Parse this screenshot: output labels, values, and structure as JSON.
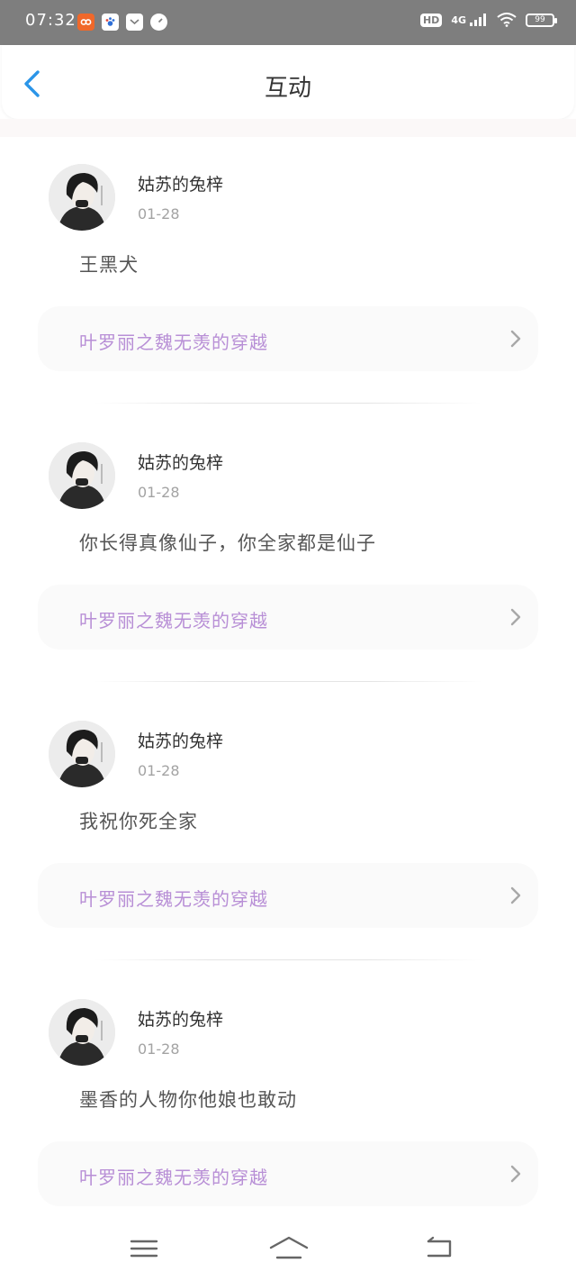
{
  "status_bar": {
    "time": "07:32",
    "hd": "HD",
    "network": "4G",
    "battery": "99"
  },
  "header": {
    "title": "互动",
    "back_icon": "chevron-left-icon"
  },
  "colors": {
    "accent": "#2b95e8",
    "book_title": "#b88fd6",
    "status_bar_bg": "#7e7e7e"
  },
  "feed": {
    "items": [
      {
        "username": "姑苏的兔梓",
        "date": "01-28",
        "comment": "王黑犬",
        "book_title": "叶罗丽之魏无羡的穿越"
      },
      {
        "username": "姑苏的兔梓",
        "date": "01-28",
        "comment": "你长得真像仙子，你全家都是仙子",
        "book_title": "叶罗丽之魏无羡的穿越"
      },
      {
        "username": "姑苏的兔梓",
        "date": "01-28",
        "comment": "我祝你死全家",
        "book_title": "叶罗丽之魏无羡的穿越"
      },
      {
        "username": "姑苏的兔梓",
        "date": "01-28",
        "comment": "墨香的人物你他娘也敢动",
        "book_title": "叶罗丽之魏无羡的穿越"
      }
    ]
  },
  "nav_bar": {
    "icons": [
      "menu-icon",
      "home-icon",
      "back-icon"
    ]
  }
}
